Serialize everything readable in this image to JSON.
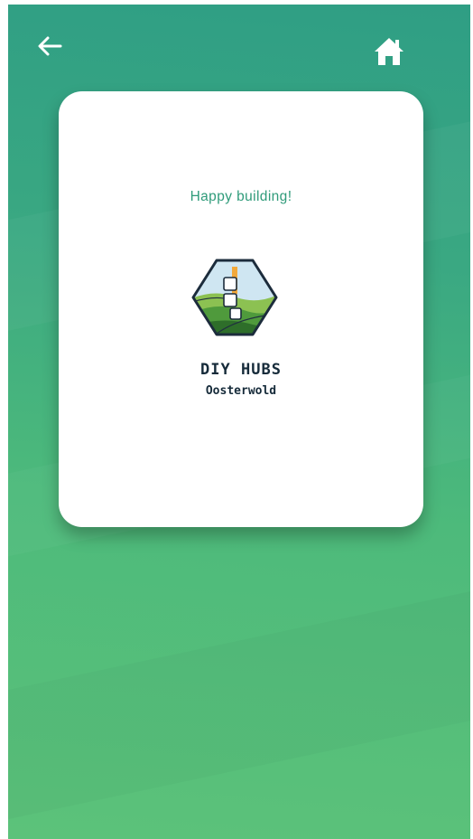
{
  "nav": {
    "back_icon": "arrow-left-icon",
    "home_icon": "home-icon"
  },
  "card": {
    "message": "Happy building!",
    "logo": {
      "icon": "diy-hubs-logo",
      "name": "DIY HUBS",
      "location": "Oosterwold"
    }
  },
  "colors": {
    "background_top": "#2f9e84",
    "background_bottom": "#5cc27a",
    "message_text": "#2f9b7a",
    "logo_text": "#162b3a",
    "card": "#ffffff"
  }
}
